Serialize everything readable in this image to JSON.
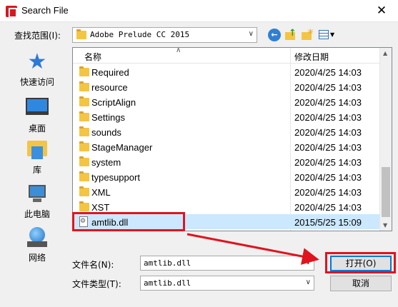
{
  "window": {
    "title": "Search File",
    "close_glyph": "✕"
  },
  "toolbar": {
    "look_in_label": "查找范围(I):",
    "look_in_value": "Adobe Prelude CC 2015",
    "icons": [
      "back-icon",
      "up-folder-icon",
      "new-folder-icon",
      "view-menu-icon"
    ]
  },
  "sidebar": {
    "items": [
      {
        "label": "快速访问",
        "icon": "star-icon"
      },
      {
        "label": "桌面",
        "icon": "desktop-icon"
      },
      {
        "label": "库",
        "icon": "library-icon"
      },
      {
        "label": "此电脑",
        "icon": "computer-icon"
      },
      {
        "label": "网络",
        "icon": "network-icon"
      }
    ]
  },
  "filelist": {
    "columns": {
      "name": "名称",
      "date": "修改日期"
    },
    "rows": [
      {
        "name": "Required",
        "date": "2020/4/25 14:03",
        "type": "folder"
      },
      {
        "name": "resource",
        "date": "2020/4/25 14:03",
        "type": "folder"
      },
      {
        "name": "ScriptAlign",
        "date": "2020/4/25 14:03",
        "type": "folder"
      },
      {
        "name": "Settings",
        "date": "2020/4/25 14:03",
        "type": "folder"
      },
      {
        "name": "sounds",
        "date": "2020/4/25 14:03",
        "type": "folder"
      },
      {
        "name": "StageManager",
        "date": "2020/4/25 14:03",
        "type": "folder"
      },
      {
        "name": "system",
        "date": "2020/4/25 14:03",
        "type": "folder"
      },
      {
        "name": "typesupport",
        "date": "2020/4/25 14:03",
        "type": "folder"
      },
      {
        "name": "XML",
        "date": "2020/4/25 14:03",
        "type": "folder"
      },
      {
        "name": "XST",
        "date": "2020/4/25 14:03",
        "type": "folder"
      },
      {
        "name": "amtlib.dll",
        "date": "2015/5/25 15:09",
        "type": "dll",
        "selected": true
      }
    ]
  },
  "filename": {
    "label": "文件名(N):",
    "value": "amtlib.dll"
  },
  "filetype": {
    "label": "文件类型(T):",
    "value": "amtlib.dll"
  },
  "buttons": {
    "open": "打开(O)",
    "cancel": "取消"
  },
  "colors": {
    "annotation": "#e0141e",
    "selection": "#cce8ff",
    "accent": "#0078d7"
  }
}
